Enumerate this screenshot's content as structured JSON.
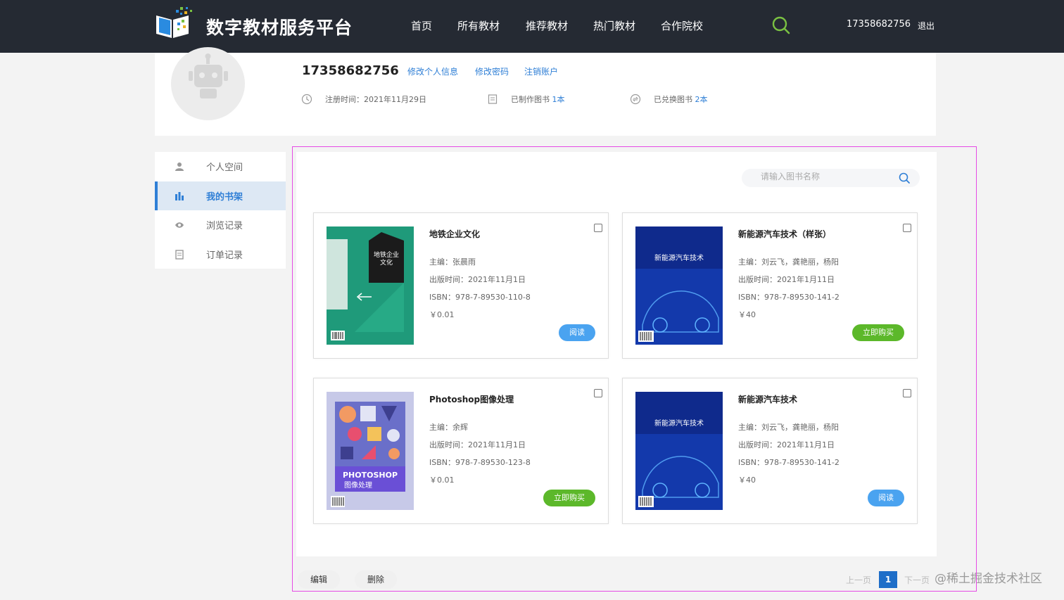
{
  "header": {
    "brand": "数字教材服务平台",
    "nav": [
      "首页",
      "所有教材",
      "推荐教材",
      "热门教材",
      "合作院校"
    ],
    "user_phone": "17358682756",
    "logout": "退出",
    "accent": "#7ac142",
    "background": "#252a33"
  },
  "profile": {
    "name": "17358682756",
    "links": [
      "修改个人信息",
      "修改密码",
      "注销账户"
    ],
    "register_label": "注册时间：2021年11月29日",
    "made_label": "已制作图书",
    "made_count": "1本",
    "exchanged_label": "已兑换图书",
    "exchanged_count": "2本"
  },
  "sidebar": {
    "items": [
      {
        "label": "个人空间",
        "icon": "user-icon"
      },
      {
        "label": "我的书架",
        "icon": "bar-chart-icon"
      },
      {
        "label": "浏览记录",
        "icon": "eye-icon"
      },
      {
        "label": "订单记录",
        "icon": "document-icon"
      }
    ],
    "active_index": 1
  },
  "search": {
    "placeholder": "请输入图书名称"
  },
  "books": [
    {
      "title": "地铁企业文化",
      "editor": "主编：张晨雨",
      "date": "出版时间：2021年11月1日",
      "isbn": "ISBN：978-7-89530-110-8",
      "price": "￥0.01",
      "action": "阅读",
      "cover_text": "地铁企业文化"
    },
    {
      "title": "新能源汽车技术（样张）",
      "editor": "主编：刘云飞，龚艳丽，杨阳",
      "date": "出版时间：2021年1月11日",
      "isbn": "ISBN：978-7-89530-141-2",
      "price": "￥40",
      "action": "立即购买",
      "cover_text": "新能源汽车技术"
    },
    {
      "title": "Photoshop图像处理",
      "editor": "主编：余辉",
      "date": "出版时间：2021年11月1日",
      "isbn": "ISBN：978-7-89530-123-8",
      "price": "￥0.01",
      "action": "立即购买",
      "cover_text": "PHOTOSHOP 图像处理"
    },
    {
      "title": "新能源汽车技术",
      "editor": "主编：刘云飞，龚艳丽，杨阳",
      "date": "出版时间：2021年11月1日",
      "isbn": "ISBN：978-7-89530-141-2",
      "price": "￥40",
      "action": "阅读",
      "cover_text": "新能源汽车技术"
    }
  ],
  "footer": {
    "edit": "编辑",
    "delete": "删除",
    "prev": "上一页",
    "page": "1",
    "next": "下一页",
    "watermark": "@稀土掘金技术社区"
  }
}
